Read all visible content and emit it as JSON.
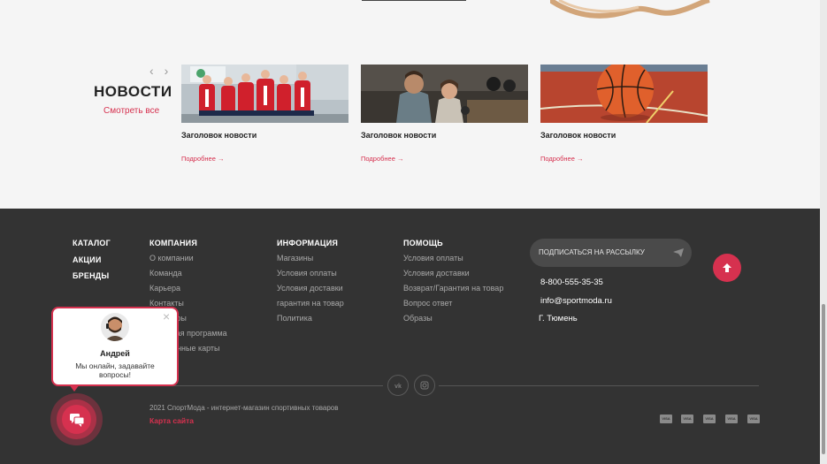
{
  "news": {
    "title": "НОВОСТИ",
    "see_all": "Смотреть все",
    "prev_arrow": "‹",
    "next_arrow": "›",
    "cards": [
      {
        "title": "Заголовок новости",
        "more": "Подробнее →",
        "image": "group-of-athletes-photo"
      },
      {
        "title": "Заголовок новости",
        "more": "Подробнее →",
        "image": "gym-couple-photo"
      },
      {
        "title": "Заголовок новости",
        "more": "Подробнее →",
        "image": "basketball-photo"
      }
    ]
  },
  "footer": {
    "main_links": [
      "КАТАЛОГ",
      "АКЦИИ",
      "БРЕНДЫ"
    ],
    "columns": [
      {
        "heading": "КОМПАНИЯ",
        "links": [
          "О компании",
          "Команда",
          "Карьера",
          "Контакты",
          "Партнеры",
          "Бонусная программа",
          "Подарочные карты"
        ]
      },
      {
        "heading": "ИНФОРМАЦИЯ",
        "links": [
          "Магазины",
          "Условия оплаты",
          "Условия доставки",
          "гарантия на товар",
          "Политика"
        ]
      },
      {
        "heading": "ПОМОЩЬ",
        "links": [
          "Условия оплаты",
          "Условия доставки",
          "Возврат/Гарантия на товар",
          "Вопрос ответ",
          "Образы"
        ]
      }
    ],
    "subscribe_label": "ПОДПИСАТЬСЯ НА РАССЫЛКУ",
    "phone": "8-800-555-35-35",
    "email": "info@sportmoda.ru",
    "city": "Г. Тюмень",
    "copyright": "2021 СпортМода - интернет-магазин спортивных товаров",
    "sitemap": "Карта сайта",
    "payment_label": "VISA"
  },
  "chat": {
    "agent_name": "Андрей",
    "message": "Мы онлайн, задавайте вопросы!",
    "close": "×"
  },
  "colors": {
    "accent": "#d6314f",
    "footer_bg": "#333333",
    "page_bg": "#f5f5f5"
  }
}
